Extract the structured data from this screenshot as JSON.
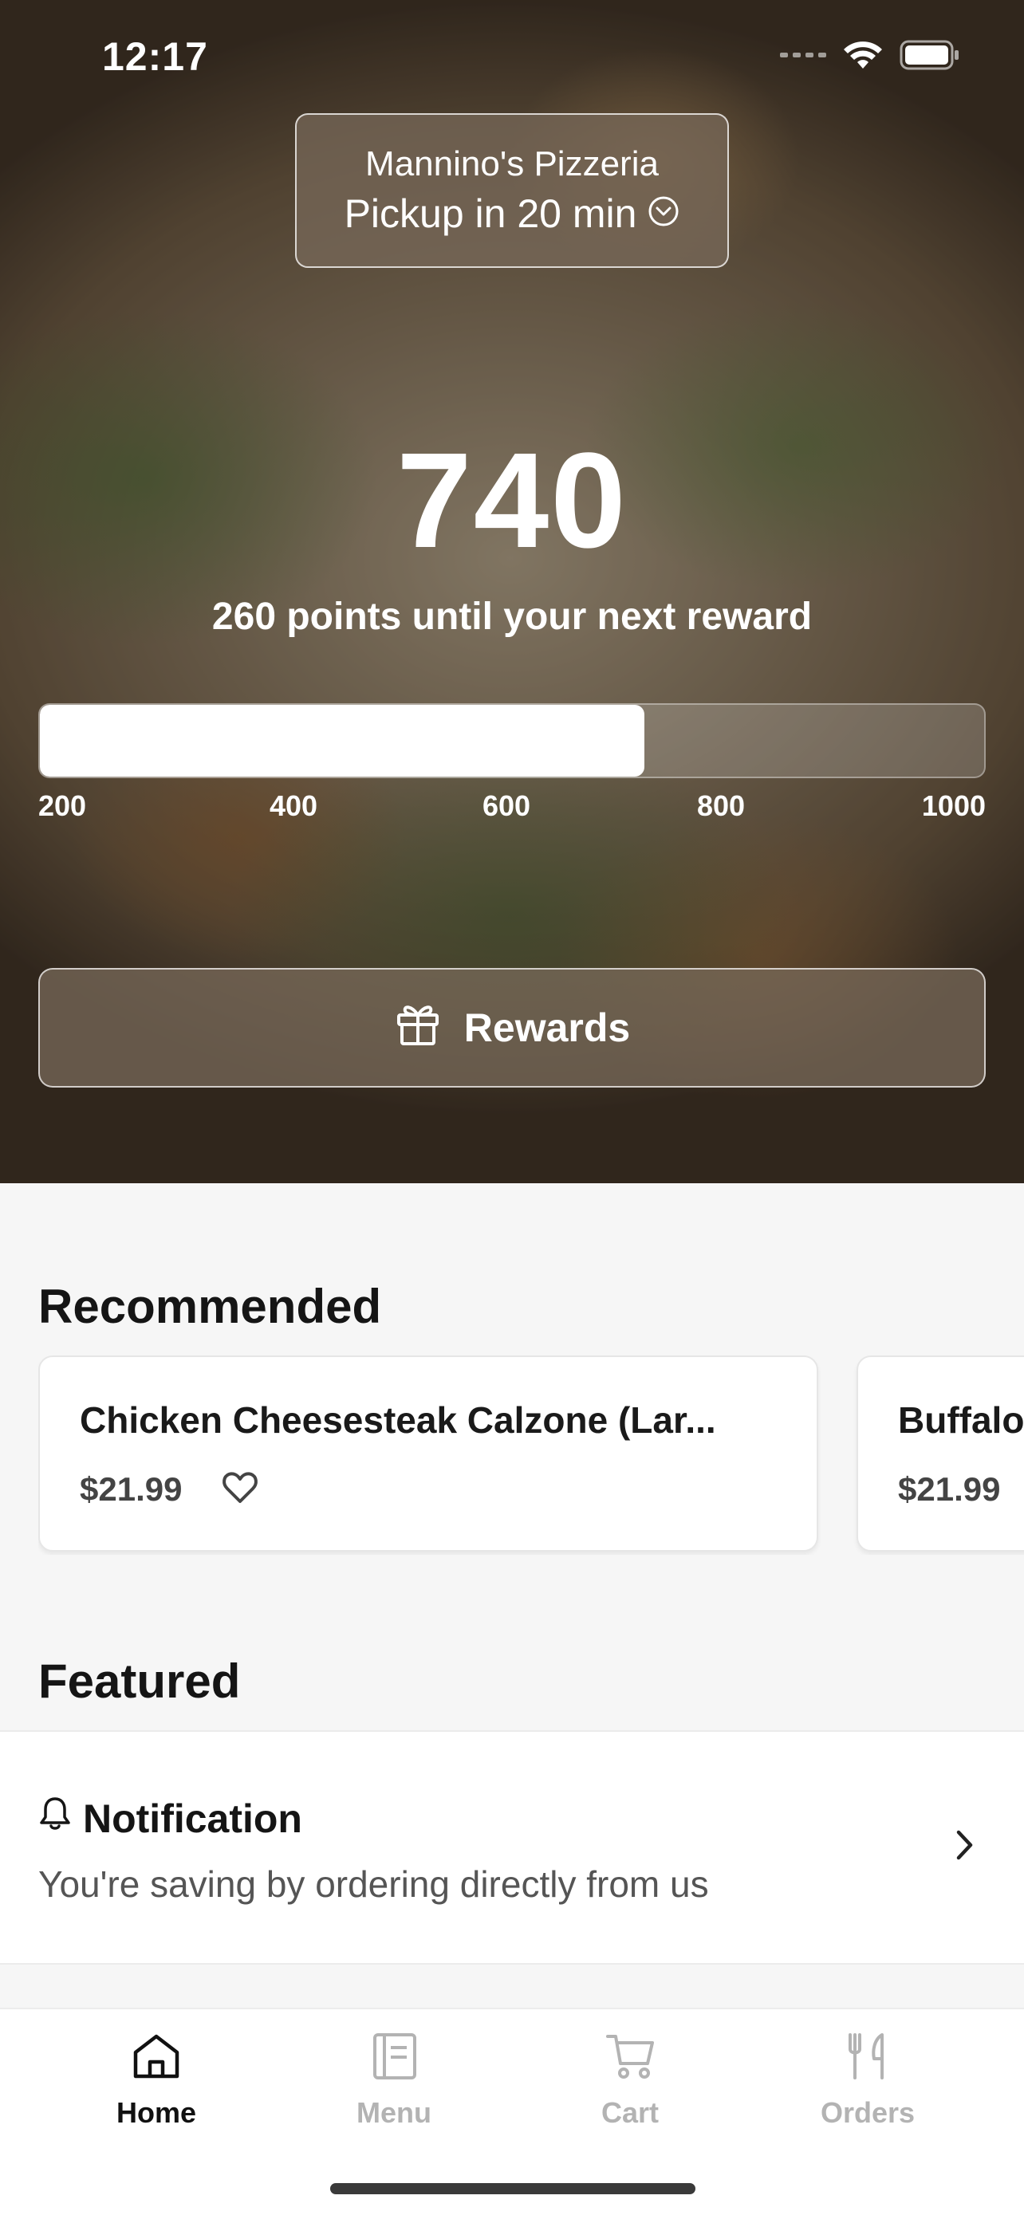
{
  "status_bar": {
    "time": "12:17"
  },
  "store": {
    "name": "Mannino's Pizzeria",
    "pickup": "Pickup in 20 min"
  },
  "points": {
    "value": "740",
    "caption": "260 points until your next reward",
    "progress_fraction": 0.64,
    "ticks": [
      "200",
      "400",
      "600",
      "800",
      "1000"
    ]
  },
  "rewards_button": {
    "label": "Rewards"
  },
  "recommended": {
    "title": "Recommended",
    "items": [
      {
        "name": "Chicken Cheesesteak Calzone (Lar...",
        "price": "$21.99"
      },
      {
        "name": "Buffalo",
        "price": "$21.99"
      }
    ]
  },
  "featured": {
    "title": "Featured",
    "notification": {
      "title": "Notification",
      "body": "You're saving by ordering directly from us"
    }
  },
  "tabs": [
    {
      "label": "Home",
      "icon": "home-icon",
      "active": true
    },
    {
      "label": "Menu",
      "icon": "menu-icon",
      "active": false
    },
    {
      "label": "Cart",
      "icon": "cart-icon",
      "active": false
    },
    {
      "label": "Orders",
      "icon": "orders-icon",
      "active": false
    }
  ],
  "colors": {
    "active_tab": "#111111",
    "inactive_tab": "#b3b3b3",
    "background": "#f6f6f6"
  }
}
